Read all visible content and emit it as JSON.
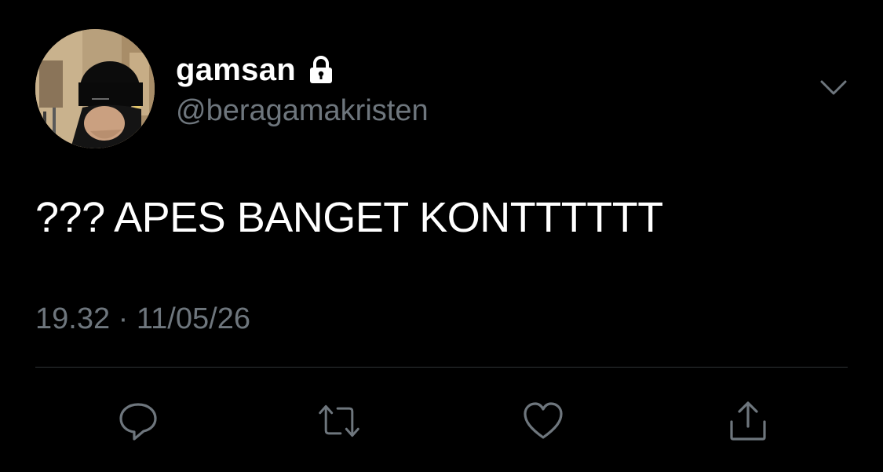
{
  "user": {
    "display_name": "gamsan",
    "handle": "@beragamakristen",
    "verified_lock_icon": "lock-icon",
    "avatar_icon": "avatar-photo"
  },
  "tweet": {
    "text": "??? APES BANGET KONTTTTTT",
    "time": "19.32",
    "separator": "·",
    "date": "11/05/26",
    "meta": "19.32 · 11/05/26"
  },
  "actions": [
    {
      "name": "reply",
      "icon": "reply-icon"
    },
    {
      "name": "retweet",
      "icon": "retweet-icon"
    },
    {
      "name": "like",
      "icon": "heart-icon"
    },
    {
      "name": "share",
      "icon": "share-icon"
    }
  ],
  "menu": {
    "icon": "chevron-down-icon"
  },
  "colors": {
    "background": "#000000",
    "primary_text": "#ffffff",
    "secondary_text": "#6e767d",
    "divider": "#2f3336",
    "icon": "#6e767d"
  }
}
